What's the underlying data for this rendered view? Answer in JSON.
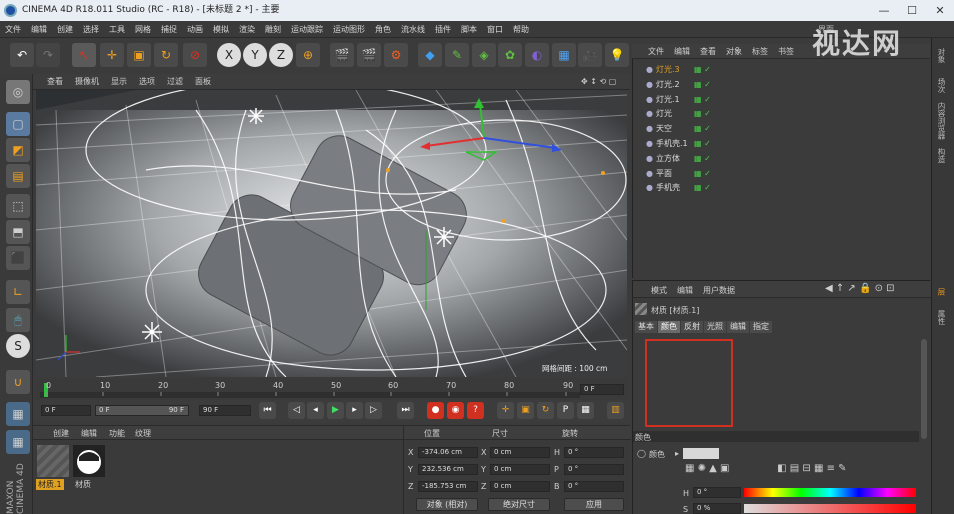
{
  "titlebar": {
    "title": "CINEMA 4D R18.011 Studio (RC - R18) - [未标题 2 *] - 主要",
    "min": "—",
    "max": "☐",
    "close": "✕"
  },
  "menu": [
    "文件",
    "编辑",
    "创建",
    "选择",
    "工具",
    "网格",
    "捕捉",
    "动画",
    "模拟",
    "渲染",
    "雕刻",
    "运动跟踪",
    "运动图形",
    "角色",
    "流水线",
    "插件",
    "脚本",
    "窗口",
    "帮助"
  ],
  "layout_label": "界面",
  "watermark": "视达网",
  "viewport": {
    "menu": [
      "查看",
      "摄像机",
      "显示",
      "选项",
      "过滤",
      "面板"
    ],
    "grid_label": "网格间距 : 100 cm"
  },
  "timeline": {
    "ticks": [
      "0",
      "10",
      "20",
      "30",
      "40",
      "50",
      "60",
      "70",
      "80",
      "90"
    ],
    "frame": "0 F"
  },
  "transport": {
    "start": "0 F",
    "range_start": "0 F",
    "range_end": "90 F",
    "end": "90 F"
  },
  "materials": {
    "menu": [
      "创建",
      "编辑",
      "功能",
      "纹理"
    ],
    "items": [
      "材质.1",
      "材质"
    ]
  },
  "coords": {
    "headers": [
      "位置",
      "尺寸",
      "旋转"
    ],
    "rows": [
      {
        "axis": "X",
        "pos": "-374.06 cm",
        "saxis": "X",
        "size": "0 cm",
        "raxis": "H",
        "rot": "0 °"
      },
      {
        "axis": "Y",
        "pos": "232.536 cm",
        "saxis": "Y",
        "size": "0 cm",
        "raxis": "P",
        "rot": "0 °"
      },
      {
        "axis": "Z",
        "pos": "-185.753 cm",
        "saxis": "Z",
        "size": "0 cm",
        "raxis": "B",
        "rot": "0 °"
      }
    ],
    "mode": "对象 (相对)",
    "size_mode": "绝对尺寸",
    "apply": "应用"
  },
  "objects": {
    "menu": [
      "文件",
      "编辑",
      "查看",
      "对象",
      "标签",
      "书签"
    ],
    "items": [
      {
        "name": "灯光.3",
        "color": "#e0a020"
      },
      {
        "name": "灯光.2",
        "color": "#dddddd"
      },
      {
        "name": "灯光.1",
        "color": "#dddddd"
      },
      {
        "name": "灯光",
        "color": "#dddddd"
      },
      {
        "name": "天空",
        "color": "#dddddd"
      },
      {
        "name": "手机壳.1",
        "color": "#dddddd"
      },
      {
        "name": "立方体",
        "color": "#dddddd"
      },
      {
        "name": "平面",
        "color": "#dddddd"
      },
      {
        "name": "手机壳",
        "color": "#dddddd"
      }
    ]
  },
  "attributes": {
    "menu": [
      "模式",
      "编辑",
      "用户数据"
    ],
    "title": "材质 [材质.1]",
    "tabs": [
      "基本",
      "颜色",
      "反射",
      "光照",
      "编辑",
      "指定"
    ],
    "active_tab": "颜色",
    "section": "颜色",
    "color_label": "颜色",
    "h_label": "H",
    "h_value": "0 °",
    "s_label": "S",
    "s_value": "0 %"
  },
  "right_tabs": [
    "对象",
    "场次",
    "内容浏览器",
    "构造",
    "层",
    "属性"
  ],
  "colors": {
    "accent": "#e0a020",
    "highlight": "#d03020"
  }
}
